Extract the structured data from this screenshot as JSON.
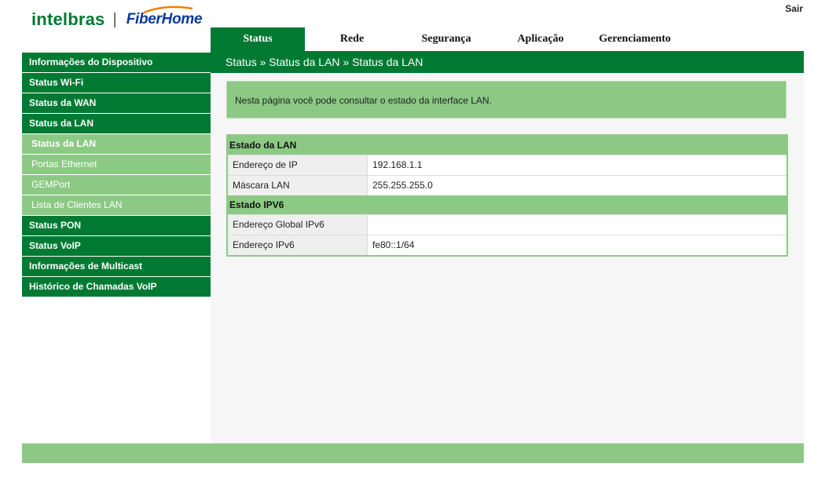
{
  "header": {
    "logo_left": "intelbras",
    "logo_right": "FiberHome",
    "logout_label": "Sair"
  },
  "nav": {
    "tabs": [
      {
        "label": "Status",
        "active": true
      },
      {
        "label": "Rede",
        "active": false
      },
      {
        "label": "Segurança",
        "active": false
      },
      {
        "label": "Aplicação",
        "active": false
      },
      {
        "label": "Gerenciamento",
        "active": false
      }
    ]
  },
  "breadcrumb": "Status » Status da LAN » Status da LAN",
  "sidebar": {
    "items": [
      {
        "label": "Informações do Dispositivo",
        "type": "main"
      },
      {
        "label": "Status Wi-Fi",
        "type": "main"
      },
      {
        "label": "Status da WAN",
        "type": "main"
      },
      {
        "label": "Status da LAN",
        "type": "main"
      },
      {
        "label": "Status da LAN",
        "type": "sub",
        "active": true
      },
      {
        "label": "Portas Ethernet",
        "type": "sub"
      },
      {
        "label": "GEMPort",
        "type": "sub"
      },
      {
        "label": "Lista de Clientes LAN",
        "type": "sub"
      },
      {
        "label": "Status PON",
        "type": "main"
      },
      {
        "label": "Status VoIP",
        "type": "main"
      },
      {
        "label": "Informações de Multicast",
        "type": "main"
      },
      {
        "label": "Histórico de Chamadas VoIP",
        "type": "main"
      }
    ]
  },
  "info_text": "Nesta página você pode consultar o estado da interface LAN.",
  "lan": {
    "title": "Estado da LAN",
    "rows": [
      {
        "label": "Endereço de IP",
        "value": "192.168.1.1"
      },
      {
        "label": "Máscara LAN",
        "value": "255.255.255.0"
      }
    ]
  },
  "ipv6": {
    "title": "Estado IPV6",
    "rows": [
      {
        "label": "Endereço Global IPv6",
        "value": ""
      },
      {
        "label": "Endereço IPv6",
        "value": "fe80::1/64"
      }
    ]
  },
  "colors": {
    "brand_green": "#007a33",
    "light_green": "#8cc985",
    "fiberhome_blue": "#0a3a9a",
    "swoosh_orange": "#f07d00"
  }
}
